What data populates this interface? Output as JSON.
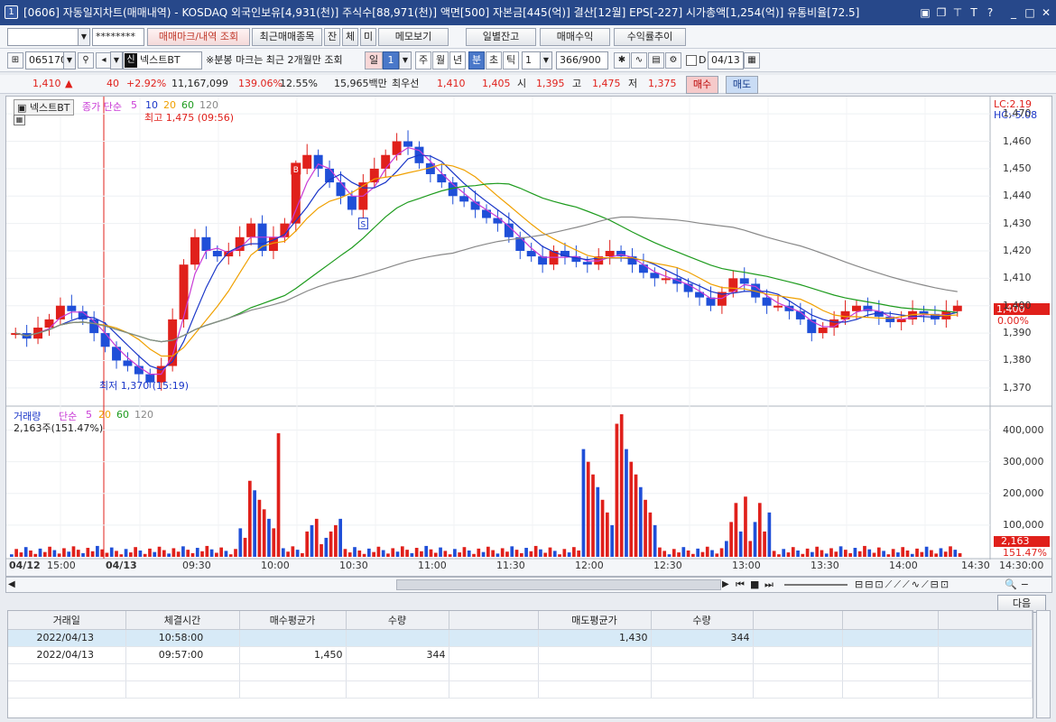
{
  "window": {
    "num": "1",
    "title": "[0606] 자동일지차트(매매내역) - KOSDAQ 외국인보유[4,931(천)] 주식수[88,971(천)] 액면[500] 자본금[445(억)] 결산[12월] EPS[-227] 시가총액[1,254(억)] 유통비율[72.5]",
    "icons": [
      "monitor-icon",
      "copy-icon",
      "pin-icon",
      "text-icon",
      "help-icon",
      "minimize-icon",
      "maximize-icon",
      "close-icon"
    ]
  },
  "toolbar1": {
    "account": "",
    "password": "********",
    "btn_mark": "매매마크/내역 조회",
    "btn_recent": "최근매매종목",
    "btn_jan": "잔",
    "btn_che": "체",
    "btn_mi": "미",
    "btn_memo": "메모보기",
    "btn_daily": "일별잔고",
    "btn_profit": "매매수익",
    "btn_rate": "수익률추이"
  },
  "toolbar2": {
    "code": "065170",
    "name": "넥스트BT",
    "badge": "신",
    "note": "※분봉 마크는 최근 2개월만 조회",
    "period_label": "일",
    "period_val": "1",
    "tabs": [
      "주",
      "월",
      "년",
      "분",
      "초",
      "틱"
    ],
    "selected_tab": "분",
    "interval": "1",
    "count": "366/900",
    "d_label": "D",
    "date": "04/13"
  },
  "quote": {
    "price": "1,410",
    "arrow": "▲",
    "change": "40",
    "pct": "+2.92%",
    "volume": "11,167,099",
    "vol_ratio": "139.06%",
    "turnover": "12.55%",
    "amount": "15,965백만",
    "bid_label": "최우선",
    "ask": "1,410",
    "bid": "1,405",
    "open_label": "시",
    "open": "1,395",
    "high_label": "고",
    "high": "1,475",
    "low_label": "저",
    "low": "1,375",
    "buy": "매수",
    "sell": "매도"
  },
  "price_panel": {
    "name_tag": "넥스트BT",
    "legend_label": "종가 단순",
    "ma": [
      "5",
      "10",
      "20",
      "60",
      "120"
    ],
    "high_annot": "최고 1,475 (09:56)",
    "low_annot": "최저 1,370 (15:19)",
    "lc": "LC:2.19",
    "hc": "HC:-5.08",
    "cur_price": "1,400",
    "cur_pct": "0.00%",
    "yticks": [
      "1,470",
      "1,460",
      "1,450",
      "1,440",
      "1,430",
      "1,420",
      "1,410",
      "1,400",
      "1,390",
      "1,380",
      "1,370"
    ]
  },
  "volume_panel": {
    "title": "거래량",
    "legend_label": "단순",
    "ma": [
      "5",
      "20",
      "60",
      "120"
    ],
    "info": "2,163주(151.47%)",
    "yticks": [
      "400,000",
      "300,000",
      "200,000",
      "100,000"
    ],
    "cur": "2,163",
    "cur_pct": "151.47%"
  },
  "time_axis": {
    "labels": [
      "04/12",
      "15:00",
      "04/13",
      "09:30",
      "10:00",
      "10:30",
      "11:00",
      "11:30",
      "12:00",
      "12:30",
      "13:00",
      "13:30",
      "14:00",
      "14:30"
    ],
    "right": "14:30:00"
  },
  "colors": {
    "up": "#e0201b",
    "down": "#1f4fd8",
    "ma5": "#c93ad6",
    "ma10": "#1a36c8",
    "ma20": "#f0a000",
    "ma60": "#1d9b1d",
    "ma120": "#888888"
  },
  "next_btn": "다음",
  "table": {
    "headers": [
      "거래일",
      "체결시간",
      "매수평균가",
      "수량",
      "",
      "매도평균가",
      "수량",
      "",
      "",
      ""
    ],
    "rows": [
      [
        "2022/04/13",
        "10:58:00",
        "",
        "",
        "",
        "1,430",
        "344",
        "",
        "",
        ""
      ],
      [
        "2022/04/13",
        "09:57:00",
        "1,450",
        "344",
        "",
        "",
        "",
        "",
        "",
        ""
      ]
    ]
  },
  "chart_data": {
    "type": "candlestick",
    "title": "넥스트BT 1분봉",
    "ylim": [
      1365,
      1475
    ],
    "yticks": [
      1370,
      1380,
      1390,
      1400,
      1410,
      1420,
      1430,
      1440,
      1450,
      1460,
      1470
    ],
    "x_labels": [
      "04/12",
      "15:00",
      "04/13",
      "09:30",
      "10:00",
      "10:30",
      "11:00",
      "11:30",
      "12:00",
      "12:30",
      "13:00",
      "13:30",
      "14:00",
      "14:30"
    ],
    "series": [
      {
        "name": "종가",
        "values": [
          1390,
          1388,
          1392,
          1395,
          1400,
          1398,
          1395,
          1390,
          1385,
          1380,
          1378,
          1375,
          1372,
          1378,
          1395,
          1415,
          1425,
          1420,
          1418,
          1420,
          1425,
          1430,
          1420,
          1425,
          1430,
          1450,
          1455,
          1450,
          1445,
          1440,
          1435,
          1445,
          1450,
          1455,
          1460,
          1458,
          1452,
          1448,
          1445,
          1440,
          1438,
          1435,
          1432,
          1430,
          1425,
          1420,
          1418,
          1415,
          1420,
          1418,
          1416,
          1415,
          1418,
          1420,
          1418,
          1415,
          1412,
          1410,
          1410,
          1408,
          1405,
          1403,
          1400,
          1405,
          1410,
          1408,
          1403,
          1400,
          1400,
          1398,
          1395,
          1390,
          1392,
          1395,
          1398,
          1400,
          1398,
          1396,
          1394,
          1395,
          1398,
          1397,
          1395,
          1398,
          1400
        ]
      }
    ],
    "volume": {
      "ylim": [
        0,
        450000
      ],
      "yticks": [
        100000,
        200000,
        300000,
        400000
      ]
    },
    "markers": [
      {
        "label": "B",
        "time": "09:57",
        "price": 1450
      },
      {
        "label": "S",
        "time": "10:58",
        "price": 1430
      }
    ],
    "high": {
      "price": 1475,
      "time": "09:56"
    },
    "low": {
      "price": 1370,
      "time": "15:19"
    }
  }
}
